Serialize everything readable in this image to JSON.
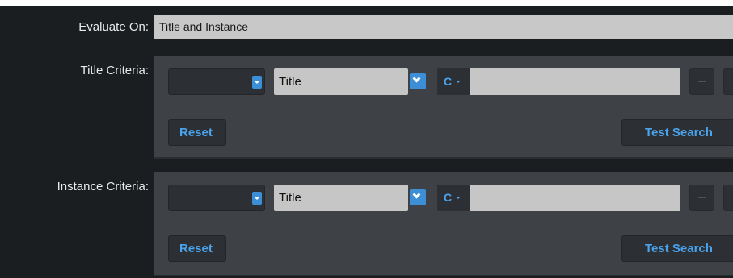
{
  "evaluate_on": {
    "label": "Evaluate On:",
    "value": "Title and Instance"
  },
  "title_criteria": {
    "label": "Title Criteria:",
    "operator_value": "",
    "field_value": "Title",
    "match_mode": "C",
    "search_value": "",
    "reset_label": "Reset",
    "test_search_label": "Test Search"
  },
  "instance_criteria": {
    "label": "Instance Criteria:",
    "operator_value": "",
    "field_value": "Title",
    "match_mode": "C",
    "search_value": "",
    "reset_label": "Reset",
    "test_search_label": "Test Search"
  },
  "icons": {
    "remove": "minus-icon",
    "add": "plus-icon",
    "dropdown": "chevron-down-icon"
  },
  "colors": {
    "accent": "#4aa3ec",
    "button_blue": "#3c8fd6",
    "background": "#1b1e21",
    "panel": "#3e4247",
    "field": "#c6c6c6"
  }
}
